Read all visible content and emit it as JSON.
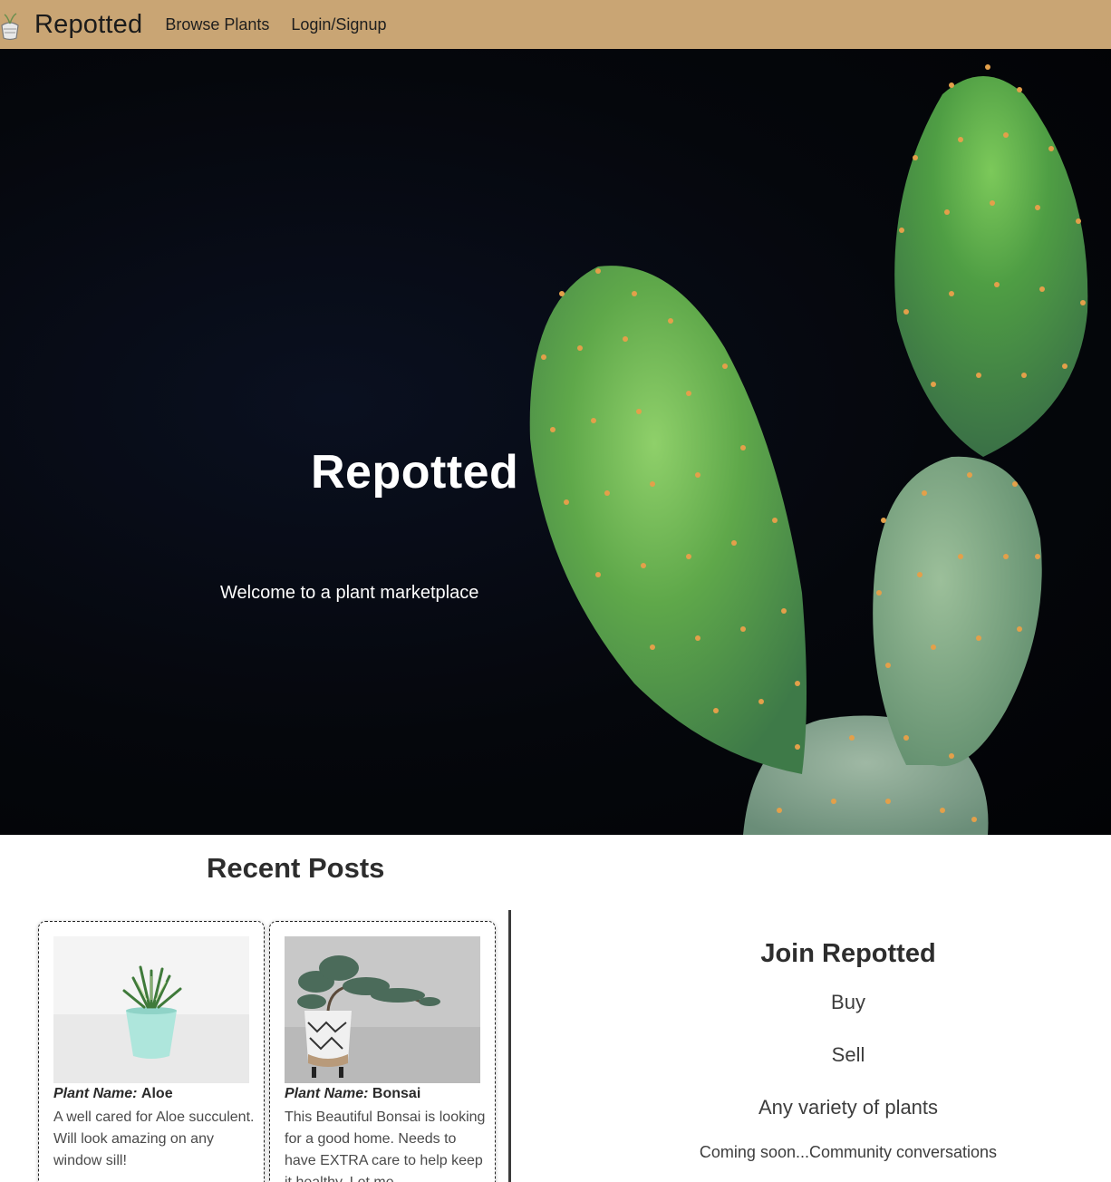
{
  "navbar": {
    "brand": "Repotted",
    "links": [
      "Browse Plants",
      "Login/Signup"
    ],
    "bg_color": "#c9a574"
  },
  "hero": {
    "title": "Repotted",
    "subtitle": "Welcome to a plant marketplace"
  },
  "recent_posts": {
    "heading": "Recent Posts",
    "posts": [
      {
        "label": "Plant Name:",
        "name": "Aloe",
        "description": "A well cared for Aloe succulent. Will look amazing on any window sill!"
      },
      {
        "label": "Plant Name:",
        "name": "Bonsai",
        "description": "This Beautiful Bonsai is looking for a good home. Needs to have EXTRA care to help keep it healthy. Let me"
      }
    ]
  },
  "join": {
    "title": "Join Repotted",
    "items": [
      "Buy",
      "Sell",
      "Any variety of plants"
    ],
    "coming_soon": "Coming soon...Community conversations"
  }
}
